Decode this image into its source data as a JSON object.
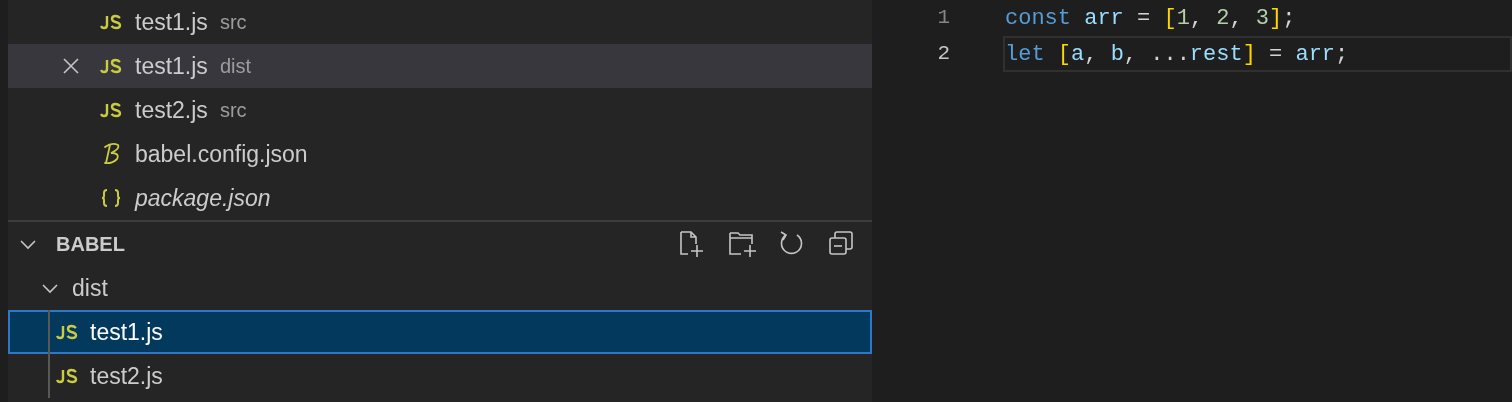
{
  "open_editors": [
    {
      "kind": "js",
      "name": "test1.js",
      "folder": "src",
      "selected": false,
      "preview": false
    },
    {
      "kind": "js",
      "name": "test1.js",
      "folder": "dist",
      "selected": true,
      "preview": false
    },
    {
      "kind": "js",
      "name": "test2.js",
      "folder": "src",
      "selected": false,
      "preview": false
    },
    {
      "kind": "babel",
      "name": "babel.config.json",
      "selected": false,
      "preview": false
    },
    {
      "kind": "json",
      "name": "package.json",
      "selected": false,
      "preview": true
    }
  ],
  "explorer": {
    "title": "BABEL",
    "expanded": true,
    "tree": [
      {
        "name": "dist",
        "kind": "folder",
        "expanded": true,
        "children": [
          {
            "name": "test1.js",
            "kind": "js",
            "selected": true
          },
          {
            "name": "test2.js",
            "kind": "js",
            "selected": false
          }
        ]
      }
    ]
  },
  "editor": {
    "lines": [
      {
        "number": "1",
        "current": false,
        "tokens": [
          {
            "kind": "keyword",
            "text": "const "
          },
          {
            "kind": "variable",
            "text": "arr"
          },
          {
            "kind": "plain",
            "text": " = "
          },
          {
            "kind": "bracket",
            "text": "["
          },
          {
            "kind": "number",
            "text": "1"
          },
          {
            "kind": "plain",
            "text": ", "
          },
          {
            "kind": "number",
            "text": "2"
          },
          {
            "kind": "plain",
            "text": ", "
          },
          {
            "kind": "number",
            "text": "3"
          },
          {
            "kind": "bracket",
            "text": "]"
          },
          {
            "kind": "plain",
            "text": ";"
          }
        ]
      },
      {
        "number": "2",
        "current": true,
        "tokens": [
          {
            "kind": "keyword",
            "text": "let "
          },
          {
            "kind": "bracket",
            "text": "["
          },
          {
            "kind": "variable",
            "text": "a"
          },
          {
            "kind": "plain",
            "text": ", "
          },
          {
            "kind": "variable",
            "text": "b"
          },
          {
            "kind": "plain",
            "text": ", ..."
          },
          {
            "kind": "variable",
            "text": "rest"
          },
          {
            "kind": "bracket",
            "text": "]"
          },
          {
            "kind": "plain",
            "text": " = "
          },
          {
            "kind": "variable",
            "text": "arr"
          },
          {
            "kind": "plain",
            "text": ";"
          }
        ]
      }
    ]
  }
}
